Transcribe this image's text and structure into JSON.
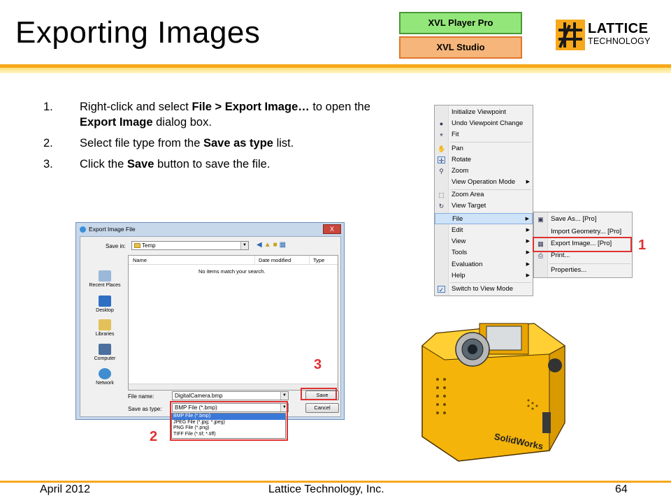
{
  "slide": {
    "title": "Exporting Images",
    "badges": [
      "XVL Player Pro",
      "XVL Studio"
    ],
    "logo": {
      "line1": "LATTICE",
      "line2": "TECHNOLOGY"
    }
  },
  "steps": [
    {
      "num": "1.",
      "parts": [
        "Right-click and select ",
        "File > Export Image…",
        " to open the ",
        "Export Image",
        " dialog box."
      ]
    },
    {
      "num": "2.",
      "parts": [
        "Select file type from the ",
        "Save as type",
        " list."
      ]
    },
    {
      "num": "3.",
      "parts": [
        "Click the ",
        "Save",
        " button to save the file."
      ]
    }
  ],
  "context_menu": {
    "items": [
      "Initialize Viewpoint",
      "Undo Viewpoint Change",
      "Fit",
      "Pan",
      "Rotate",
      "Zoom",
      "View Operation Mode",
      "Zoom Area",
      "View Target",
      "File",
      "Edit",
      "View",
      "Tools",
      "Evaluation",
      "Help",
      "Switch to View Mode"
    ],
    "submenu": [
      "Save As... [Pro]",
      "Import Geometry... [Pro]",
      "Export Image... [Pro]",
      "Print...",
      "Properties..."
    ]
  },
  "dialog": {
    "title": "Export Image File",
    "close": "X",
    "save_in_label": "Save in:",
    "save_in_value": "Temp",
    "places": [
      "Recent Places",
      "Desktop",
      "Libraries",
      "Computer",
      "Network"
    ],
    "columns": [
      "Name",
      "Date modified",
      "Type"
    ],
    "empty_message": "No items match your search.",
    "file_name_label": "File name:",
    "file_name_value": "DigitalCamera.bmp",
    "save_type_label": "Save as type:",
    "save_type_value": "BMP File (*.bmp)",
    "type_options": [
      "BMP File (*.bmp)",
      "JPEG File (*.jpg; *.jpeg)",
      "PNG File (*.png)",
      "TIFF File (*.tif; *.tiff)"
    ],
    "save_button": "Save",
    "cancel_button": "Cancel"
  },
  "callouts": [
    "1",
    "2",
    "3"
  ],
  "camera_label": "SolidWorks",
  "footer": {
    "date": "April 2012",
    "company": "Lattice Technology, Inc.",
    "page": "64"
  },
  "colors": {
    "accent": "#f7a81b",
    "callout": "#e03030",
    "player_badge": "#93e67a",
    "studio_badge": "#f6b57a"
  }
}
